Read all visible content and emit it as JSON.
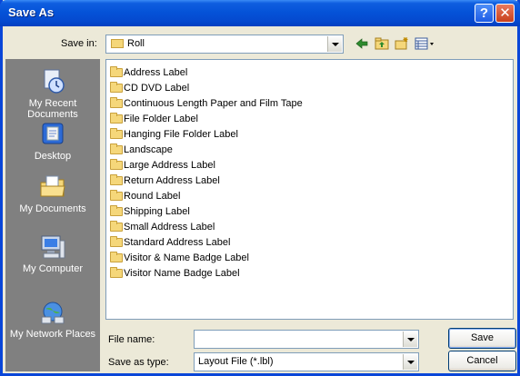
{
  "window": {
    "title": "Save As",
    "help_glyph": "?",
    "close_glyph": "✕"
  },
  "save_in": {
    "label": "Save in:",
    "value": "Roll"
  },
  "places": [
    {
      "label": "My Recent Documents",
      "icon": "recent-documents-icon"
    },
    {
      "label": "Desktop",
      "icon": "desktop-icon"
    },
    {
      "label": "My Documents",
      "icon": "my-documents-icon"
    },
    {
      "label": "My Computer",
      "icon": "my-computer-icon"
    },
    {
      "label": "My Network Places",
      "icon": "network-places-icon"
    }
  ],
  "files": [
    "Address Label",
    "CD DVD Label",
    "Continuous Length Paper and Film Tape",
    "File Folder Label",
    "Hanging File Folder Label",
    "Landscape",
    "Large Address Label",
    "Return Address Label",
    "Round Label",
    "Shipping Label",
    "Small Address Label",
    "Standard Address Label",
    "Visitor & Name Badge Label",
    "Visitor Name Badge Label"
  ],
  "file_name": {
    "label": "File name:",
    "value": ""
  },
  "save_as_type": {
    "label": "Save as type:",
    "value": "Layout File (*.lbl)"
  },
  "buttons": {
    "save": "Save",
    "cancel": "Cancel"
  },
  "colors": {
    "title_bar": "#0553d8",
    "places_bar": "#808080",
    "dialog_bg": "#ece9d8"
  }
}
